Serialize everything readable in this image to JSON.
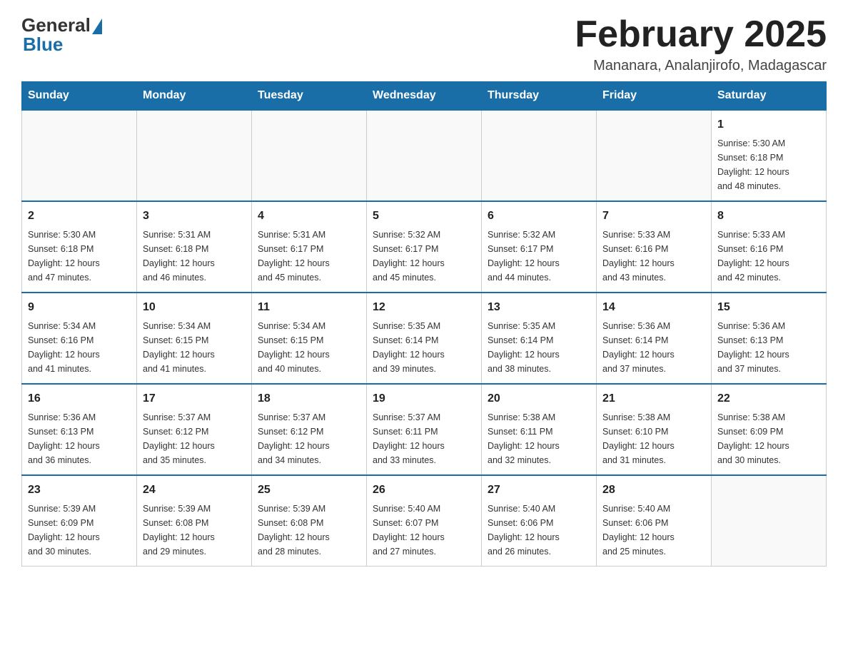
{
  "logo": {
    "general": "General",
    "blue": "Blue"
  },
  "title": "February 2025",
  "subtitle": "Mananara, Analanjirofo, Madagascar",
  "days": [
    "Sunday",
    "Monday",
    "Tuesday",
    "Wednesday",
    "Thursday",
    "Friday",
    "Saturday"
  ],
  "weeks": [
    [
      {
        "num": "",
        "info": ""
      },
      {
        "num": "",
        "info": ""
      },
      {
        "num": "",
        "info": ""
      },
      {
        "num": "",
        "info": ""
      },
      {
        "num": "",
        "info": ""
      },
      {
        "num": "",
        "info": ""
      },
      {
        "num": "1",
        "info": "Sunrise: 5:30 AM\nSunset: 6:18 PM\nDaylight: 12 hours\nand 48 minutes."
      }
    ],
    [
      {
        "num": "2",
        "info": "Sunrise: 5:30 AM\nSunset: 6:18 PM\nDaylight: 12 hours\nand 47 minutes."
      },
      {
        "num": "3",
        "info": "Sunrise: 5:31 AM\nSunset: 6:18 PM\nDaylight: 12 hours\nand 46 minutes."
      },
      {
        "num": "4",
        "info": "Sunrise: 5:31 AM\nSunset: 6:17 PM\nDaylight: 12 hours\nand 45 minutes."
      },
      {
        "num": "5",
        "info": "Sunrise: 5:32 AM\nSunset: 6:17 PM\nDaylight: 12 hours\nand 45 minutes."
      },
      {
        "num": "6",
        "info": "Sunrise: 5:32 AM\nSunset: 6:17 PM\nDaylight: 12 hours\nand 44 minutes."
      },
      {
        "num": "7",
        "info": "Sunrise: 5:33 AM\nSunset: 6:16 PM\nDaylight: 12 hours\nand 43 minutes."
      },
      {
        "num": "8",
        "info": "Sunrise: 5:33 AM\nSunset: 6:16 PM\nDaylight: 12 hours\nand 42 minutes."
      }
    ],
    [
      {
        "num": "9",
        "info": "Sunrise: 5:34 AM\nSunset: 6:16 PM\nDaylight: 12 hours\nand 41 minutes."
      },
      {
        "num": "10",
        "info": "Sunrise: 5:34 AM\nSunset: 6:15 PM\nDaylight: 12 hours\nand 41 minutes."
      },
      {
        "num": "11",
        "info": "Sunrise: 5:34 AM\nSunset: 6:15 PM\nDaylight: 12 hours\nand 40 minutes."
      },
      {
        "num": "12",
        "info": "Sunrise: 5:35 AM\nSunset: 6:14 PM\nDaylight: 12 hours\nand 39 minutes."
      },
      {
        "num": "13",
        "info": "Sunrise: 5:35 AM\nSunset: 6:14 PM\nDaylight: 12 hours\nand 38 minutes."
      },
      {
        "num": "14",
        "info": "Sunrise: 5:36 AM\nSunset: 6:14 PM\nDaylight: 12 hours\nand 37 minutes."
      },
      {
        "num": "15",
        "info": "Sunrise: 5:36 AM\nSunset: 6:13 PM\nDaylight: 12 hours\nand 37 minutes."
      }
    ],
    [
      {
        "num": "16",
        "info": "Sunrise: 5:36 AM\nSunset: 6:13 PM\nDaylight: 12 hours\nand 36 minutes."
      },
      {
        "num": "17",
        "info": "Sunrise: 5:37 AM\nSunset: 6:12 PM\nDaylight: 12 hours\nand 35 minutes."
      },
      {
        "num": "18",
        "info": "Sunrise: 5:37 AM\nSunset: 6:12 PM\nDaylight: 12 hours\nand 34 minutes."
      },
      {
        "num": "19",
        "info": "Sunrise: 5:37 AM\nSunset: 6:11 PM\nDaylight: 12 hours\nand 33 minutes."
      },
      {
        "num": "20",
        "info": "Sunrise: 5:38 AM\nSunset: 6:11 PM\nDaylight: 12 hours\nand 32 minutes."
      },
      {
        "num": "21",
        "info": "Sunrise: 5:38 AM\nSunset: 6:10 PM\nDaylight: 12 hours\nand 31 minutes."
      },
      {
        "num": "22",
        "info": "Sunrise: 5:38 AM\nSunset: 6:09 PM\nDaylight: 12 hours\nand 30 minutes."
      }
    ],
    [
      {
        "num": "23",
        "info": "Sunrise: 5:39 AM\nSunset: 6:09 PM\nDaylight: 12 hours\nand 30 minutes."
      },
      {
        "num": "24",
        "info": "Sunrise: 5:39 AM\nSunset: 6:08 PM\nDaylight: 12 hours\nand 29 minutes."
      },
      {
        "num": "25",
        "info": "Sunrise: 5:39 AM\nSunset: 6:08 PM\nDaylight: 12 hours\nand 28 minutes."
      },
      {
        "num": "26",
        "info": "Sunrise: 5:40 AM\nSunset: 6:07 PM\nDaylight: 12 hours\nand 27 minutes."
      },
      {
        "num": "27",
        "info": "Sunrise: 5:40 AM\nSunset: 6:06 PM\nDaylight: 12 hours\nand 26 minutes."
      },
      {
        "num": "28",
        "info": "Sunrise: 5:40 AM\nSunset: 6:06 PM\nDaylight: 12 hours\nand 25 minutes."
      },
      {
        "num": "",
        "info": ""
      }
    ]
  ]
}
